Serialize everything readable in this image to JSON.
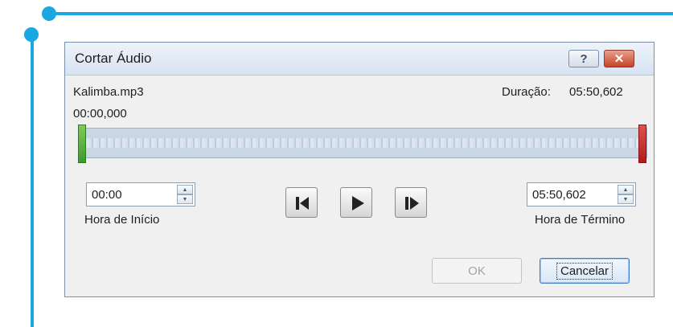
{
  "dialog": {
    "title": "Cortar Áudio",
    "help_label": "?",
    "close_label": "✕"
  },
  "file": {
    "name": "Kalimba.mp3",
    "duration_label": "Duração:",
    "duration_value": "05:50,602",
    "current_position": "00:00,000"
  },
  "start": {
    "value": "00:00",
    "label": "Hora de Início"
  },
  "end": {
    "value": "05:50,602",
    "label": "Hora de Término"
  },
  "playback": {
    "previous_icon": "previous-frame-icon",
    "play_icon": "play-icon",
    "next_icon": "next-frame-icon"
  },
  "buttons": {
    "ok_label": "OK",
    "cancel_label": "Cancelar"
  },
  "colors": {
    "accent_line": "#1ba8e0",
    "start_marker": "#3f9a2c",
    "end_marker": "#b01c1c"
  }
}
